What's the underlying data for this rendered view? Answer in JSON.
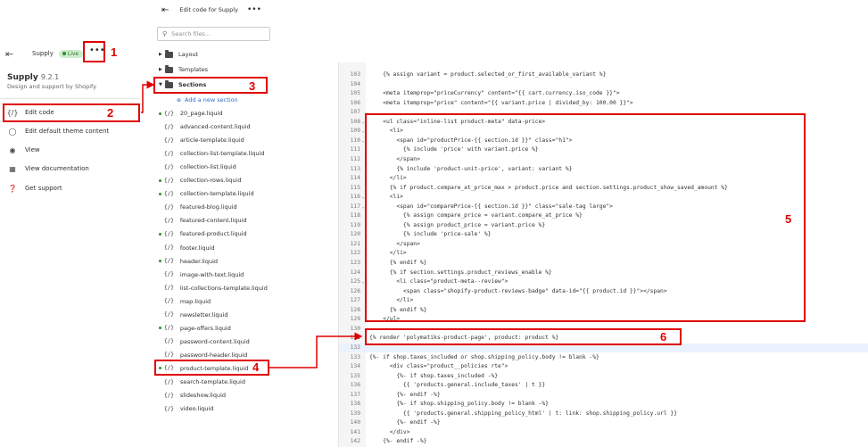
{
  "theme_panel": {
    "store_name": "Supply",
    "live_label": "Live",
    "more": "•••",
    "theme_title": "Supply",
    "theme_version": "9.2.1",
    "theme_subtitle": "Design and support by Shopify",
    "menu": [
      {
        "label": "Edit code",
        "icon": "code-icon"
      },
      {
        "label": "Edit default theme content",
        "icon": "globe-icon"
      },
      {
        "label": "View",
        "icon": "eye-icon"
      },
      {
        "label": "View documentation",
        "icon": "document-icon"
      },
      {
        "label": "Get support",
        "icon": "question-icon"
      }
    ]
  },
  "files_panel": {
    "header_title": "Edit code for Supply",
    "more": "•••",
    "search_placeholder": "Search files...",
    "folders": {
      "layout": "Layout",
      "templates": "Templates",
      "sections": "Sections"
    },
    "add_section": "Add a new section",
    "liquid_tag": "{/}",
    "files": [
      "20_page.liquid",
      "advanced-content.liquid",
      "article-template.liquid",
      "collection-list-template.liquid",
      "collection-list.liquid",
      "collection-rows.liquid",
      "collection-template.liquid",
      "featured-blog.liquid",
      "featured-content.liquid",
      "featured-product.liquid",
      "footer.liquid",
      "header.liquid",
      "image-with-text.liquid",
      "list-collections-template.liquid",
      "map.liquid",
      "newsletter.liquid",
      "page-offers.liquid",
      "password-content.liquid",
      "password-header.liquid",
      "product-template.liquid",
      "search-template.liquid",
      "slideshow.liquid",
      "video.liquid"
    ]
  },
  "editor": {
    "lines": [
      {
        "n": "103",
        "t": "    {% assign variant = product.selected_or_first_available_variant %}"
      },
      {
        "n": "104",
        "t": ""
      },
      {
        "n": "105",
        "t": "    <meta itemprop=\"priceCurrency\" content=\"{{ cart.currency.iso_code }}\">"
      },
      {
        "n": "106",
        "t": "    <meta itemprop=\"price\" content=\"{{ variant.price | divided_by: 100.00 }}\">"
      },
      {
        "n": "107",
        "t": ""
      },
      {
        "n": "108",
        "t": "    <ul class=\"inline-list product-meta\" data-price>"
      },
      {
        "n": "109",
        "t": "      <li>"
      },
      {
        "n": "110",
        "t": "        <span id=\"productPrice-{{ section.id }}\" class=\"h1\">"
      },
      {
        "n": "111",
        "t": "          {% include 'price' with variant.price %}"
      },
      {
        "n": "112",
        "t": "        </span>"
      },
      {
        "n": "113",
        "t": "        {% include 'product-unit-price', variant: variant %}"
      },
      {
        "n": "114",
        "t": "      </li>"
      },
      {
        "n": "115",
        "t": "      {% if product.compare_at_price_max > product.price and section.settings.product_show_saved_amount %}"
      },
      {
        "n": "116",
        "t": "      <li>"
      },
      {
        "n": "117",
        "t": "        <span id=\"comparePrice-{{ section.id }}\" class=\"sale-tag large\">"
      },
      {
        "n": "118",
        "t": "          {% assign compare_price = variant.compare_at_price %}"
      },
      {
        "n": "119",
        "t": "          {% assign product_price = variant.price %}"
      },
      {
        "n": "120",
        "t": "          {% include 'price-sale' %}"
      },
      {
        "n": "121",
        "t": "        </span>"
      },
      {
        "n": "122",
        "t": "      </li>"
      },
      {
        "n": "123",
        "t": "      {% endif %}"
      },
      {
        "n": "124",
        "t": "      {% if section.settings.product_reviews_enable %}"
      },
      {
        "n": "125",
        "t": "        <li class=\"product-meta--review\">"
      },
      {
        "n": "126",
        "t": "          <span class=\"shopify-product-reviews-badge\" data-id=\"{{ product.id }}\"></span>"
      },
      {
        "n": "127",
        "t": "        </li>"
      },
      {
        "n": "128",
        "t": "      {% endif %}"
      },
      {
        "n": "129",
        "t": "    </ul>"
      },
      {
        "n": "130",
        "t": ""
      },
      {
        "n": "131",
        "t": "{% render 'polymatiks-product-page', product: product %}"
      },
      {
        "n": "132",
        "t": ""
      },
      {
        "n": "133",
        "t": "{%- if shop.taxes_included or shop.shipping_policy.body != blank -%}"
      },
      {
        "n": "134",
        "t": "      <div class=\"product__policies rte\">"
      },
      {
        "n": "135",
        "t": "        {%- if shop.taxes_included -%}"
      },
      {
        "n": "136",
        "t": "          {{ 'products.general.include_taxes' | t }}"
      },
      {
        "n": "137",
        "t": "        {%- endif -%}"
      },
      {
        "n": "138",
        "t": "        {%- if shop.shipping_policy.body != blank -%}"
      },
      {
        "n": "139",
        "t": "          {{ 'products.general.shipping_policy_html' | t: link: shop.shipping_policy.url }}"
      },
      {
        "n": "140",
        "t": "        {%- endif -%}"
      },
      {
        "n": "141",
        "t": "      </div>"
      },
      {
        "n": "142",
        "t": "    {%- endif -%}"
      }
    ]
  },
  "annotations": [
    "1",
    "2",
    "3",
    "4",
    "5",
    "6"
  ],
  "colors": {
    "annotation": "#e00000",
    "link": "#2c6ecb",
    "live_badge": "#cdeecb"
  }
}
